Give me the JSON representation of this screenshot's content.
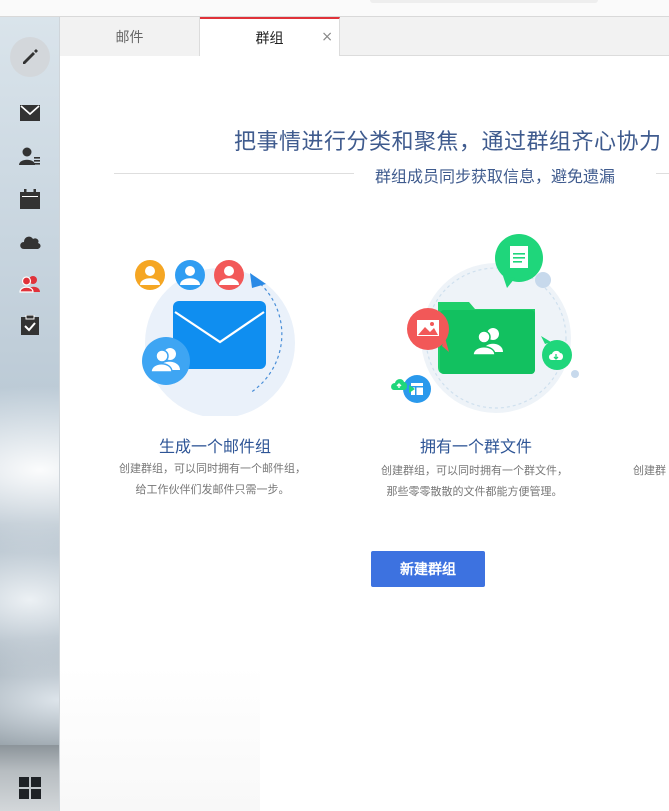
{
  "tabs": [
    {
      "label": "邮件",
      "active": false
    },
    {
      "label": "群组",
      "active": true,
      "close": "×"
    }
  ],
  "sidebar": {
    "compose": "pencil-icon",
    "items": [
      {
        "icon": "mail-icon"
      },
      {
        "icon": "contacts-icon"
      },
      {
        "icon": "calendar-icon"
      },
      {
        "icon": "cloud-icon"
      },
      {
        "icon": "groups-icon",
        "active": true
      },
      {
        "icon": "tasks-icon"
      }
    ],
    "bottom": "apps-grid-icon"
  },
  "main": {
    "headline": "把事情进行分类和聚焦，通过群组齐心协力",
    "subline": "群组成员同步获取信息，避免遗漏",
    "features": [
      {
        "title": "生成一个邮件组",
        "desc1": "创建群组，可以同时拥有一个邮件组，",
        "desc2": "给工作伙伴们发邮件只需一步。"
      },
      {
        "title": "拥有一个群文件",
        "desc1": "创建群组，可以同时拥有一个群文件，",
        "desc2": "那些零零散散的文件都能方便管理。"
      },
      {
        "title": "",
        "desc1": "创建群",
        "desc2": ""
      }
    ],
    "create_button": "新建群组"
  },
  "colors": {
    "accent_tab": "#e0323a",
    "button": "#3d72e0",
    "headline": "#3f5b8e",
    "mail_blue": "#1a90f0",
    "folder_green": "#25d16b"
  }
}
